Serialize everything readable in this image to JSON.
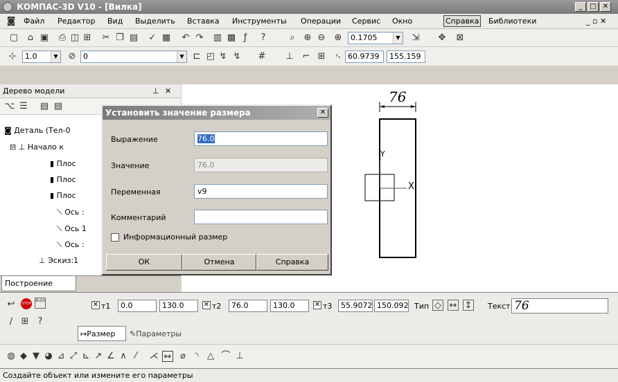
{
  "window": {
    "title": "КОМПАС-3D V10 - [Вилка]"
  },
  "menu": [
    "Файл",
    "Редактор",
    "Вид",
    "Выделить",
    "Вставка",
    "Инструменты",
    "Операции",
    "Сервис",
    "Окно",
    "Справка",
    "Библиотеки"
  ],
  "toolbar1": {
    "zoom": "0.1705"
  },
  "toolbar2": {
    "line_scale": "1.0",
    "layer": "0",
    "coord_x": "60.9739",
    "coord_y": "155.159"
  },
  "tree": {
    "header": "Дерево модели",
    "items": [
      "Деталь (Тел-0",
      "Начало к",
      "Плос",
      "Плос",
      "Плос",
      "Ось :",
      "Ось 1",
      "Ось :",
      "Эскиз:1"
    ],
    "tab": "Построение"
  },
  "canvas": {
    "dimension_label": "76",
    "axis_x": "X",
    "axis_y": "Y"
  },
  "dialog": {
    "title": "Установить значение размера",
    "expression_label": "Выражение",
    "expression_value": "76.0",
    "value_label": "Значение",
    "value_value": "76.0",
    "variable_label": "Переменная",
    "variable_value": "v9",
    "comment_label": "Комментарий",
    "comment_value": "",
    "info_checkbox_label": "Информационный размер",
    "ok": "ОК",
    "cancel": "Отмена",
    "help": "Справка"
  },
  "props": {
    "t1_label": "т1",
    "t1_x": "0.0",
    "t1_y": "130.0",
    "t2_label": "т2",
    "t2_x": "76.0",
    "t2_y": "130.0",
    "t3_label": "т3",
    "t3_x": "55.9072",
    "t3_y": "150.092",
    "type_label": "Тип",
    "text_label": "Текст",
    "text_value": "76",
    "tab_size": "Размер",
    "tab_params": "Параметры",
    "stop": "STOP",
    "auto": "Auto"
  },
  "status": "Создайте объект или измените его параметры"
}
